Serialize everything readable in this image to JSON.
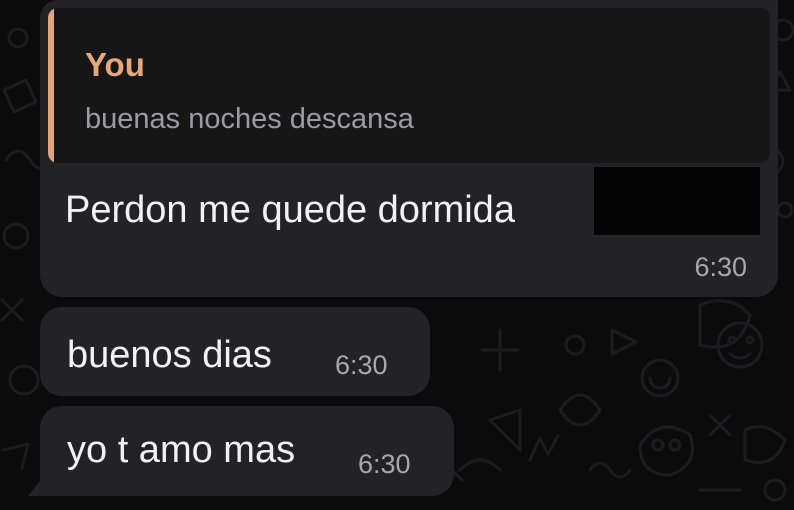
{
  "chat": {
    "messages": [
      {
        "reply_to": {
          "author": "You",
          "text": "buenas noches descansa"
        },
        "text": "Perdon me quede dormida",
        "time": "6:30",
        "has_redaction": true
      },
      {
        "text": "buenos dias",
        "time": "6:30"
      },
      {
        "text": "yo t amo mas",
        "time": "6:30"
      }
    ]
  },
  "colors": {
    "background": "#0b0b0c",
    "bubble": "#232325",
    "quote_background": "#161617",
    "quote_accent": "#e3a57d",
    "message_text": "#f2f2f2",
    "timestamp_text": "#a8a8ab"
  }
}
